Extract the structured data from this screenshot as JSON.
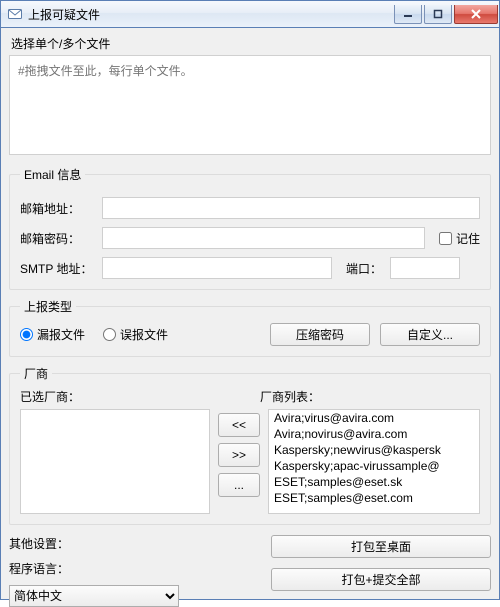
{
  "window": {
    "title": "上报可疑文件"
  },
  "files": {
    "label": "选择单个/多个文件",
    "placeholder": "#拖拽文件至此，每行单个文件。"
  },
  "email": {
    "legend": "Email 信息",
    "addr_label": "邮箱地址：",
    "pass_label": "邮箱密码：",
    "remember_label": "记住",
    "smtp_label": "SMTP 地址：",
    "port_label": "端口："
  },
  "type": {
    "legend": "上报类型",
    "miss": "漏报文件",
    "false": "误报文件",
    "zip_btn": "压缩密码",
    "custom_btn": "自定义..."
  },
  "vendor": {
    "legend": "厂商",
    "selected_label": "已选厂商：",
    "list_label": "厂商列表：",
    "btn_addall": "<<",
    "btn_add": ">>",
    "btn_more": "...",
    "list": [
      "Avira;virus@avira.com",
      "Avira;novirus@avira.com",
      "Kaspersky;newvirus@kaspersk",
      "Kaspersky;apac-virussample@",
      "ESET;samples@eset.sk",
      "ESET;samples@eset.com"
    ]
  },
  "bottom": {
    "other_label": "其他设置：",
    "lang_label": "程序语言：",
    "lang_value": "简体中文",
    "pack_desktop": "打包至桌面",
    "pack_submit": "打包+提交全部"
  }
}
